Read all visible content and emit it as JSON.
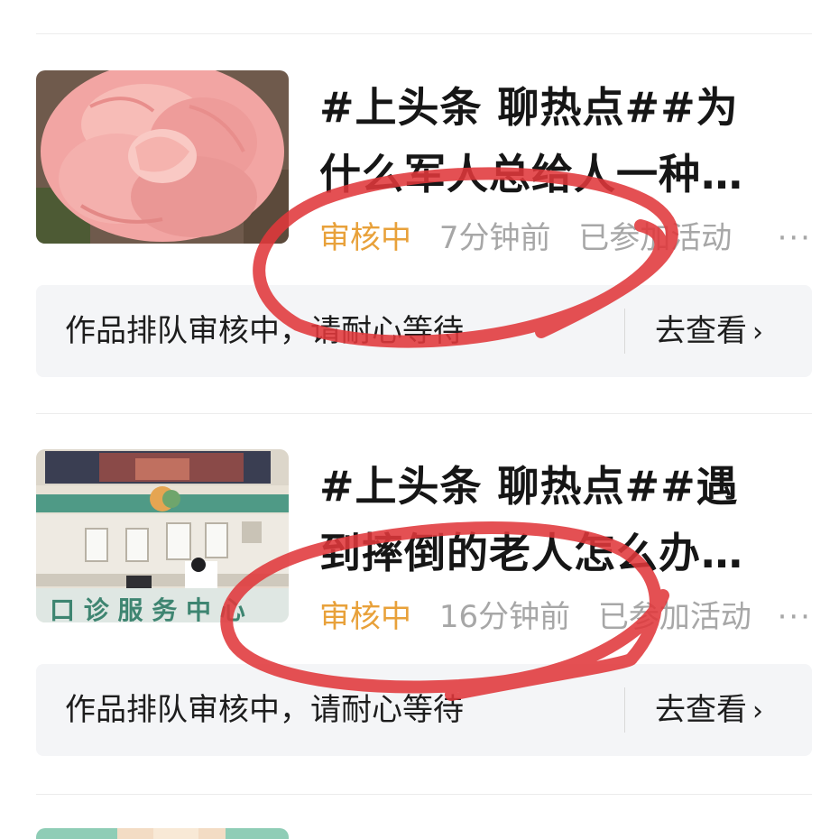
{
  "items": [
    {
      "title_line1": "#上头条 聊热点##为",
      "title_line2": "什么军人总给人一种…",
      "status": "审核中",
      "time": "7分钟前",
      "activity": "已参加活动",
      "more": "···",
      "notice": "作品排队审核中，请耐心等待",
      "action": "去查看",
      "chevron": "›",
      "thumbnail": "pink-flower-photo"
    },
    {
      "title_line1": "#上头条 聊热点##遇",
      "title_line2": "到摔倒的老人怎么办…",
      "status": "审核中",
      "time": "16分钟前",
      "activity": "已参加活动",
      "more": "···",
      "notice": "作品排队审核中，请耐心等待",
      "action": "去查看",
      "chevron": "›",
      "thumbnail": "service-hall-photo"
    }
  ],
  "colors": {
    "status": "#e8a13a",
    "meta": "#a7a7a7",
    "banner_bg": "#f4f5f7",
    "annotation": "#e0383b"
  }
}
